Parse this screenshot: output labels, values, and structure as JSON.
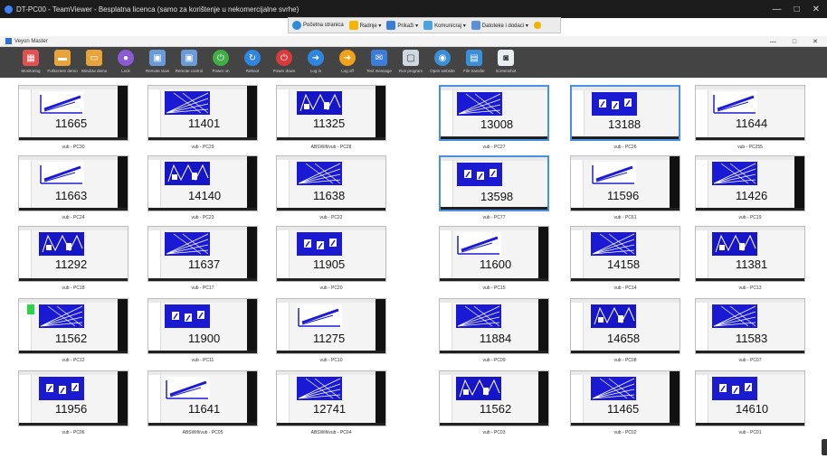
{
  "window": {
    "title": "DT-PC00 - TeamViewer - Besplatna licenca (samo za korištenje u nekomercijalne svrhe)",
    "controls": [
      "—",
      "□",
      "✕"
    ]
  },
  "teamviewer_toolbar": {
    "items": [
      {
        "label": "Početna stranica",
        "icon": "home-icon",
        "color": "#2e8bd6"
      },
      {
        "label": "Radnje ▾",
        "icon": "lightning-icon",
        "color": "#f2b705"
      },
      {
        "label": "Prikaži ▾",
        "icon": "monitor-icon",
        "color": "#3b7dd8"
      },
      {
        "label": "Komunicraj ▾",
        "icon": "chat-icon",
        "color": "#4aa3df"
      },
      {
        "label": "Datoteke i dodaci ▾",
        "icon": "file-icon",
        "color": "#5b8fd6"
      }
    ]
  },
  "app": {
    "title": "Veyon Master",
    "controls": [
      "—",
      "□",
      "✕"
    ]
  },
  "toolbar": {
    "buttons": [
      {
        "label": "Monitoring",
        "icon": "monitoring-icon",
        "color": "#e05252"
      },
      {
        "label": "Fullscreen demo",
        "icon": "fullscreen-demo-icon",
        "color": "#e8a33a"
      },
      {
        "label": "Window demo",
        "icon": "window-demo-icon",
        "color": "#e8a33a"
      },
      {
        "label": "Lock",
        "icon": "lock-icon",
        "color": "#8b5bd6"
      },
      {
        "label": "Remote view",
        "icon": "remote-view-icon",
        "color": "#6a9bd8"
      },
      {
        "label": "Remote control",
        "icon": "remote-control-icon",
        "color": "#6a9bd8"
      },
      {
        "label": "Power on",
        "icon": "power-on-icon",
        "color": "#3fae45"
      },
      {
        "label": "Reboot",
        "icon": "reboot-icon",
        "color": "#2e86de"
      },
      {
        "label": "Power down",
        "icon": "power-down-icon",
        "color": "#d93a3a"
      },
      {
        "label": "Log in",
        "icon": "log-in-icon",
        "color": "#2e86de"
      },
      {
        "label": "Log off",
        "icon": "log-off-icon",
        "color": "#f0a21b"
      },
      {
        "label": "Text message",
        "icon": "text-message-icon",
        "color": "#3b7dd8"
      },
      {
        "label": "Run program",
        "icon": "run-program-icon",
        "color": "#cfd8e0"
      },
      {
        "label": "Open website",
        "icon": "open-website-icon",
        "color": "#3b8ed8"
      },
      {
        "label": "File transfer",
        "icon": "file-transfer-icon",
        "color": "#3b8ed8"
      },
      {
        "label": "Screenshot",
        "icon": "screenshot-icon",
        "color": "#e8eef4"
      }
    ]
  },
  "computers": [
    {
      "number": "11665",
      "name": "vub - PC30"
    },
    {
      "number": "11401",
      "name": "vub - PC29"
    },
    {
      "number": "11325",
      "name": "ABSWifi/vub - PC28"
    },
    {
      "number": "13008",
      "name": "vub - PC27"
    },
    {
      "number": "13188",
      "name": "vub - PC26"
    },
    {
      "number": "11644",
      "name": "vub - PC255"
    },
    {
      "number": "11663",
      "name": "vub - PC24"
    },
    {
      "number": "14140",
      "name": "vub - PC23"
    },
    {
      "number": "11638",
      "name": "vub - PC22"
    },
    {
      "number": "13598",
      "name": "vub - PC77"
    },
    {
      "number": "11596",
      "name": "vub - PC61"
    },
    {
      "number": "11426",
      "name": "vub - PC19"
    },
    {
      "number": "11292",
      "name": "vub - PC18"
    },
    {
      "number": "11637",
      "name": "vub - PC17"
    },
    {
      "number": "11905",
      "name": "vub - PC20"
    },
    {
      "number": "11600",
      "name": "vub - PC15"
    },
    {
      "number": "14158",
      "name": "vub - PC14"
    },
    {
      "number": "11381",
      "name": "vub - PC13"
    },
    {
      "number": "11562",
      "name": "vub - PC12"
    },
    {
      "number": "11900",
      "name": "vub - PC11"
    },
    {
      "number": "11275",
      "name": "vub - PC10"
    },
    {
      "number": "11884",
      "name": "vub - PC09"
    },
    {
      "number": "14658",
      "name": "vub - PC08"
    },
    {
      "number": "11583",
      "name": "vub - PC07"
    },
    {
      "number": "11956",
      "name": "vub - PC06"
    },
    {
      "number": "11641",
      "name": "ABSWifi/vub - PC05"
    },
    {
      "number": "12741",
      "name": "ABSWifi/vub - PC04"
    },
    {
      "number": "11562",
      "name": "vub - PC03"
    },
    {
      "number": "11465",
      "name": "vub - PC02"
    },
    {
      "number": "14610",
      "name": "vub - PC01"
    }
  ]
}
